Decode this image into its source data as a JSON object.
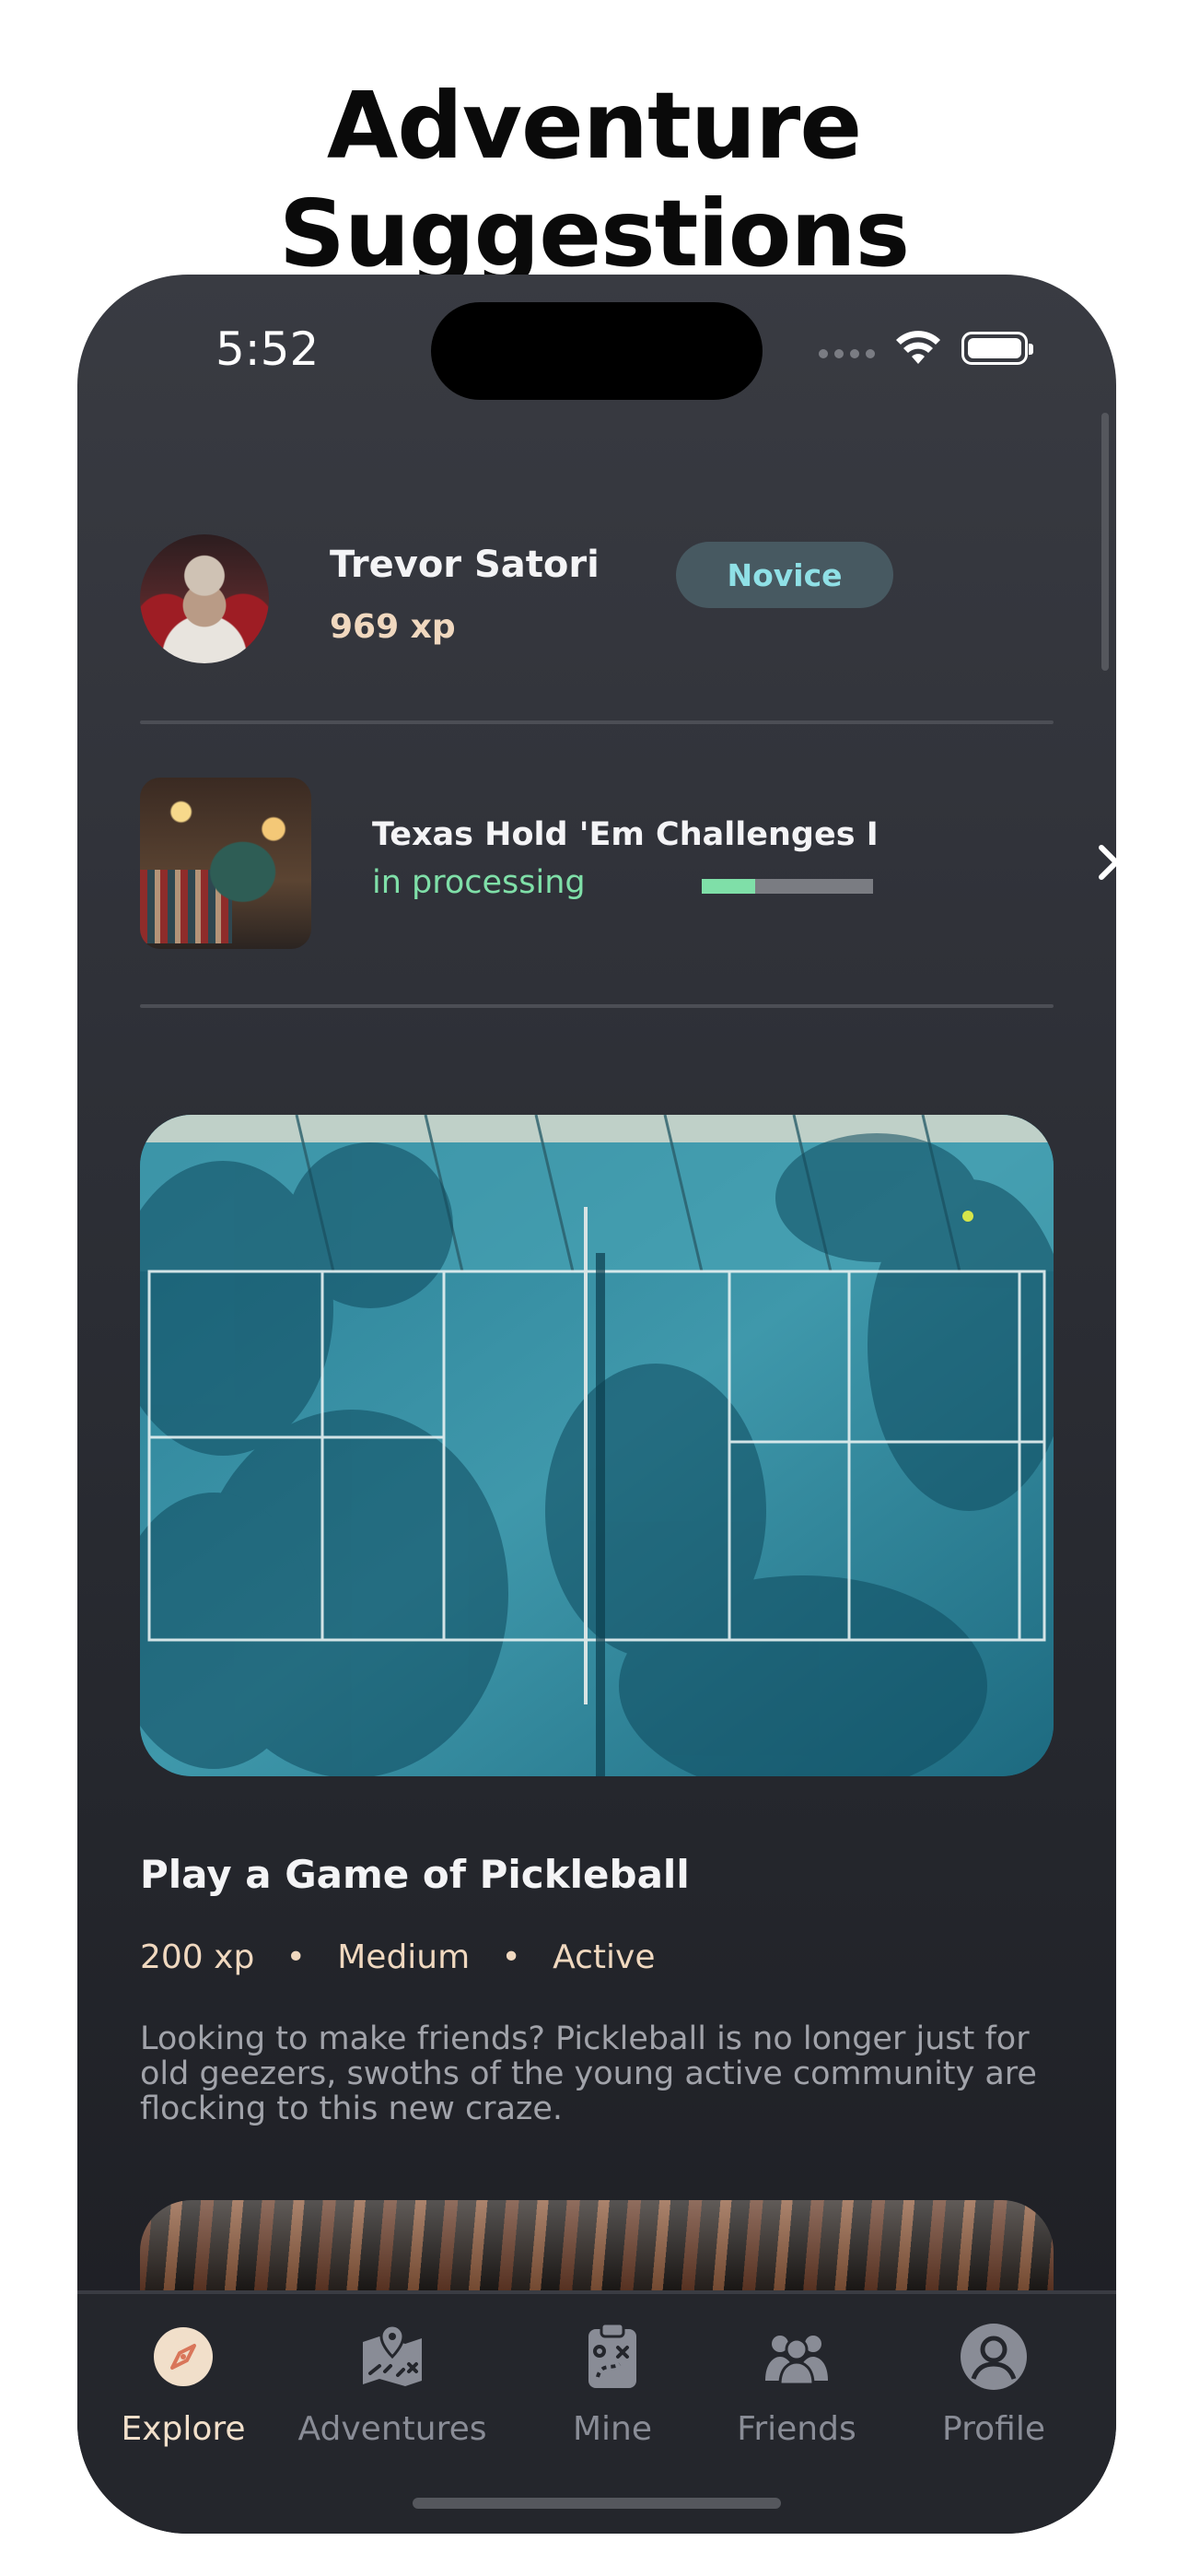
{
  "page": {
    "title": "Adventure Suggestions"
  },
  "status_bar": {
    "time": "5:52",
    "icons": [
      "signal-dots",
      "wifi-icon",
      "battery-icon"
    ]
  },
  "profile": {
    "name": "Trevor Satori",
    "xp": "969 xp",
    "level": "Novice"
  },
  "current_challenge": {
    "title": "Texas Hold 'Em Challenges I",
    "status": "in processing",
    "progress": 0.31,
    "accent": "#7fdfa8"
  },
  "suggestion": {
    "title": "Play a Game of Pickleball",
    "xp": "200 xp",
    "separator": "•",
    "difficulty": "Medium",
    "category": "Active",
    "description": "Looking to make friends? Pickleball is no longer just for old geezers, swoths of the young active community are flocking to this new craze."
  },
  "tabbar": {
    "tabs": [
      {
        "label": "Explore",
        "icon": "compass-icon",
        "active": true
      },
      {
        "label": "Adventures",
        "icon": "map-icon",
        "active": false
      },
      {
        "label": "Mine",
        "icon": "clipboard-icon",
        "active": false
      },
      {
        "label": "Friends",
        "icon": "friends-icon",
        "active": false
      },
      {
        "label": "Profile",
        "icon": "person-icon",
        "active": false
      }
    ]
  },
  "colors": {
    "xp_text": "#f0d8bf",
    "badge_bg": "#475961",
    "badge_text": "#8fe0e6",
    "active_tab": "#f1dfca",
    "inactive_tab": "#898c96"
  }
}
